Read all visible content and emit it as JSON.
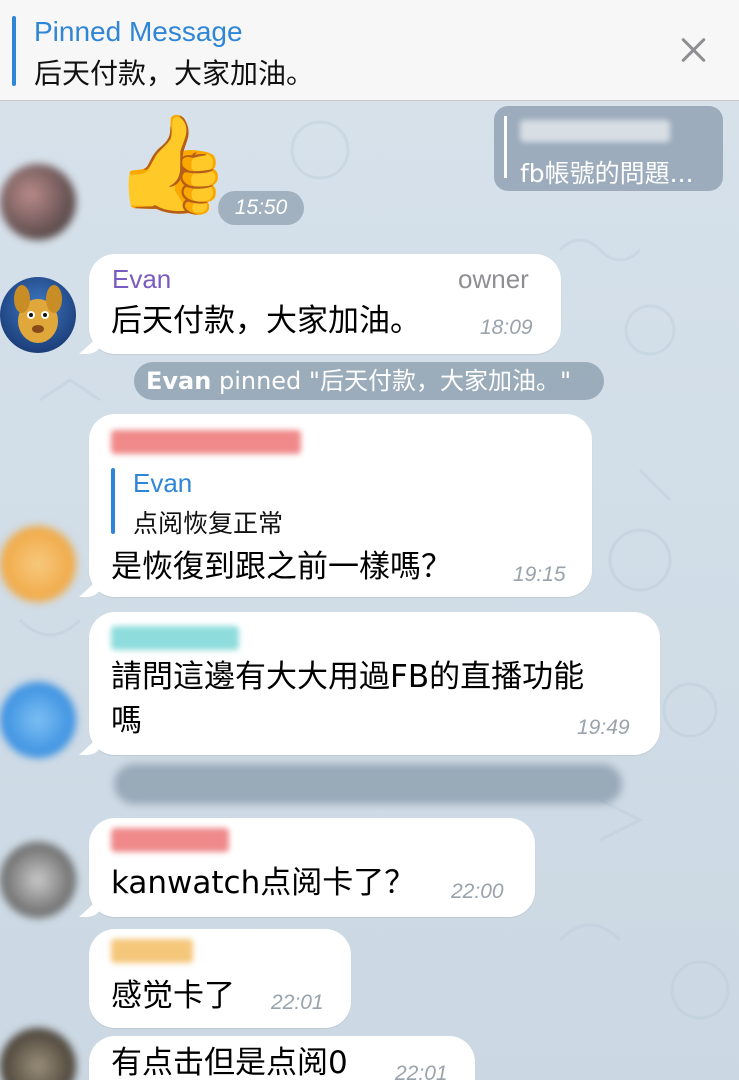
{
  "pinned": {
    "title": "Pinned Message",
    "text": "后天付款，大家加油。"
  },
  "messages": {
    "sticker": {
      "emoji": "👍",
      "time": "15:50"
    },
    "reply_preview": {
      "text": "fb帳號的問題..."
    },
    "evan": {
      "sender": "Evan",
      "role": "owner",
      "text": "后天付款，大家加油。",
      "time": "18:09"
    },
    "service_pinned": {
      "actor": "Evan",
      "rest": " pinned \"后天付款，大家加油。\""
    },
    "m1": {
      "quote_sender": "Evan",
      "quote_text": "点阅恢复正常",
      "text": "是恢復到跟之前一樣嗎？",
      "time": "19:15"
    },
    "m2": {
      "line1": "請問這邊有大大用過FB的直播功能",
      "line2": "嗎",
      "time": "19:49"
    },
    "m3": {
      "text": "kanwatch点阅卡了？",
      "time": "22:00"
    },
    "m4": {
      "text": "感觉卡了",
      "time": "22:01"
    },
    "m5": {
      "text": "有点击但是点阅0",
      "time": "22:01"
    }
  },
  "colors": {
    "accent": "#2f86d6",
    "evan_name": "#7b5bbf",
    "chat_bg": "#d4dfe8"
  }
}
